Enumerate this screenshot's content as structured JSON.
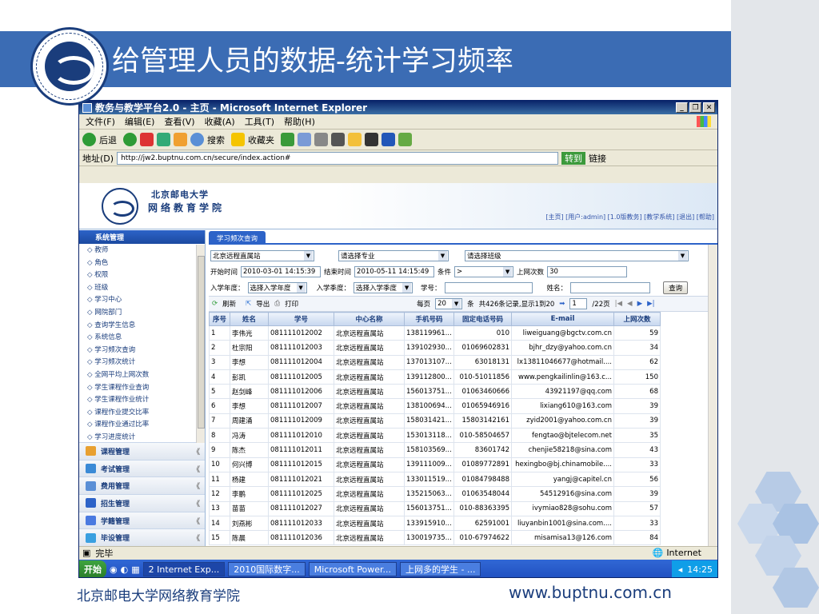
{
  "slide": {
    "title": "给管理人员的数据-统计学习频率",
    "footer_left": "北京邮电大学网络教育学院",
    "footer_right": "www.buptnu.com.cn"
  },
  "ie": {
    "title": "教务与教学平台2.0 - 主页 - Microsoft Internet Explorer",
    "menu": [
      "文件(F)",
      "编辑(E)",
      "查看(V)",
      "收藏(A)",
      "工具(T)",
      "帮助(H)"
    ],
    "back": "后退",
    "search": "搜索",
    "favorites": "收藏夹",
    "address_label": "地址(D)",
    "address": "http://jw2.buptnu.com.cn/secure/index.action#",
    "go": "转到",
    "links": "链接"
  },
  "banner": {
    "name1": "北京邮电大学",
    "name2": "网络教育学院",
    "links": "[主页] [用户:admin] [1.0版教务] [教学系统] [退出] [帮助]"
  },
  "sidebar": {
    "header": "系统管理",
    "items": [
      "教师",
      "角色",
      "权限",
      "班级",
      "学习中心",
      "网院部门",
      "查询学生信息",
      "系统信息",
      "学习频次查询",
      "学习频次统计",
      "全网平均上网次数",
      "学生课程作业查询",
      "学生课程作业统计",
      "课程作业提交比率",
      "课程作业通过比率",
      "学习进度统计"
    ],
    "groups": [
      "课程管理",
      "考试管理",
      "费用管理",
      "招生管理",
      "学籍管理",
      "毕设管理"
    ]
  },
  "content": {
    "tab": "学习频次查询",
    "center_select": "北京远程直属站",
    "major_select": "请选择专业",
    "class_select": "请选择班级",
    "start_label": "开始时间",
    "start_value": "2010-03-01 14:15:39",
    "end_label": "结束时间",
    "end_value": "2010-05-11 14:15:49",
    "cond_label": "条件",
    "cond_value": ">",
    "count_label": "上网次数",
    "count_value": "30",
    "year_label": "入学年度：",
    "year_value": "选择入学年度",
    "season_label": "入学季度：",
    "season_value": "选择入学季度",
    "sno_label": "学号：",
    "name_label": "姓名：",
    "query_btn": "查询",
    "refresh": "刷新",
    "export": "导出",
    "print": "打印",
    "per_page_label": "每页",
    "per_page": "20",
    "unit": "条",
    "summary": "共426条记录,显示1到20",
    "page_no": "1",
    "page_total": "/22页"
  },
  "table": {
    "headers": [
      "序号",
      "姓名",
      "学号",
      "中心名称",
      "手机号码",
      "固定电话号码",
      "E-mail",
      "上网次数"
    ],
    "rows": [
      [
        "1",
        "李伟光",
        "081111012002",
        "北京远程直属站",
        "138119961...",
        "010",
        "liweiguang@bgctv.com.cn",
        "59"
      ],
      [
        "2",
        "杜宗阳",
        "081111012003",
        "北京远程直属站",
        "139102930...",
        "01069602831",
        "bjhr_dzy@yahoo.com.cn",
        "34"
      ],
      [
        "3",
        "李想",
        "081111012004",
        "北京远程直属站",
        "137013107...",
        "63018131",
        "lx13811046677@hotmail....",
        "62"
      ],
      [
        "4",
        "彭凯",
        "081111012005",
        "北京远程直属站",
        "139112800...",
        "010-51011856",
        "www.pengkailinlin@163.c...",
        "150"
      ],
      [
        "5",
        "赵剑峰",
        "081111012006",
        "北京远程直属站",
        "156013751...",
        "01063460666",
        "43921197@qq.com",
        "68"
      ],
      [
        "6",
        "李想",
        "081111012007",
        "北京远程直属站",
        "138100694...",
        "01065946916",
        "lixiang610@163.com",
        "39"
      ],
      [
        "7",
        "周建涌",
        "081111012009",
        "北京远程直属站",
        "158031421...",
        "15803142161",
        "zyid2001@yahoo.com.cn",
        "39"
      ],
      [
        "8",
        "冯涛",
        "081111012010",
        "北京远程直属站",
        "153013118...",
        "010-58504657",
        "fengtao@bjtelecom.net",
        "35"
      ],
      [
        "9",
        "陈杰",
        "081111012011",
        "北京远程直属站",
        "158103569...",
        "83601742",
        "chenjie58218@sina.com",
        "43"
      ],
      [
        "10",
        "何兴博",
        "081111012015",
        "北京远程直属站",
        "139111009...",
        "01089772891",
        "hexingbo@bj.chinamobile....",
        "33"
      ],
      [
        "11",
        "杨建",
        "081111012021",
        "北京远程直属站",
        "133011519...",
        "01084798488",
        "yangj@capitel.cn",
        "56"
      ],
      [
        "12",
        "李鹏",
        "081111012025",
        "北京远程直属站",
        "135215063...",
        "01063548044",
        "54512916@sina.com",
        "39"
      ],
      [
        "13",
        "苗苗",
        "081111012027",
        "北京远程直属站",
        "156013751...",
        "010-88363395",
        "ivymiao828@sohu.com",
        "57"
      ],
      [
        "14",
        "刘燕彬",
        "081111012033",
        "北京远程直属站",
        "133915910...",
        "62591001",
        "liuyanbin1001@sina.com....",
        "33"
      ],
      [
        "15",
        "陈晨",
        "081111012036",
        "北京远程直属站",
        "130019735...",
        "010-67974622",
        "misamisa13@126.com",
        "84"
      ]
    ]
  },
  "status": {
    "done": "完毕",
    "zone": "Internet"
  },
  "taskbar": {
    "start": "开始",
    "items": [
      "2 Internet Exp...",
      "2010国际数字...",
      "Microsoft Power...",
      "上网多的学生 - ..."
    ],
    "time": "14:25"
  }
}
